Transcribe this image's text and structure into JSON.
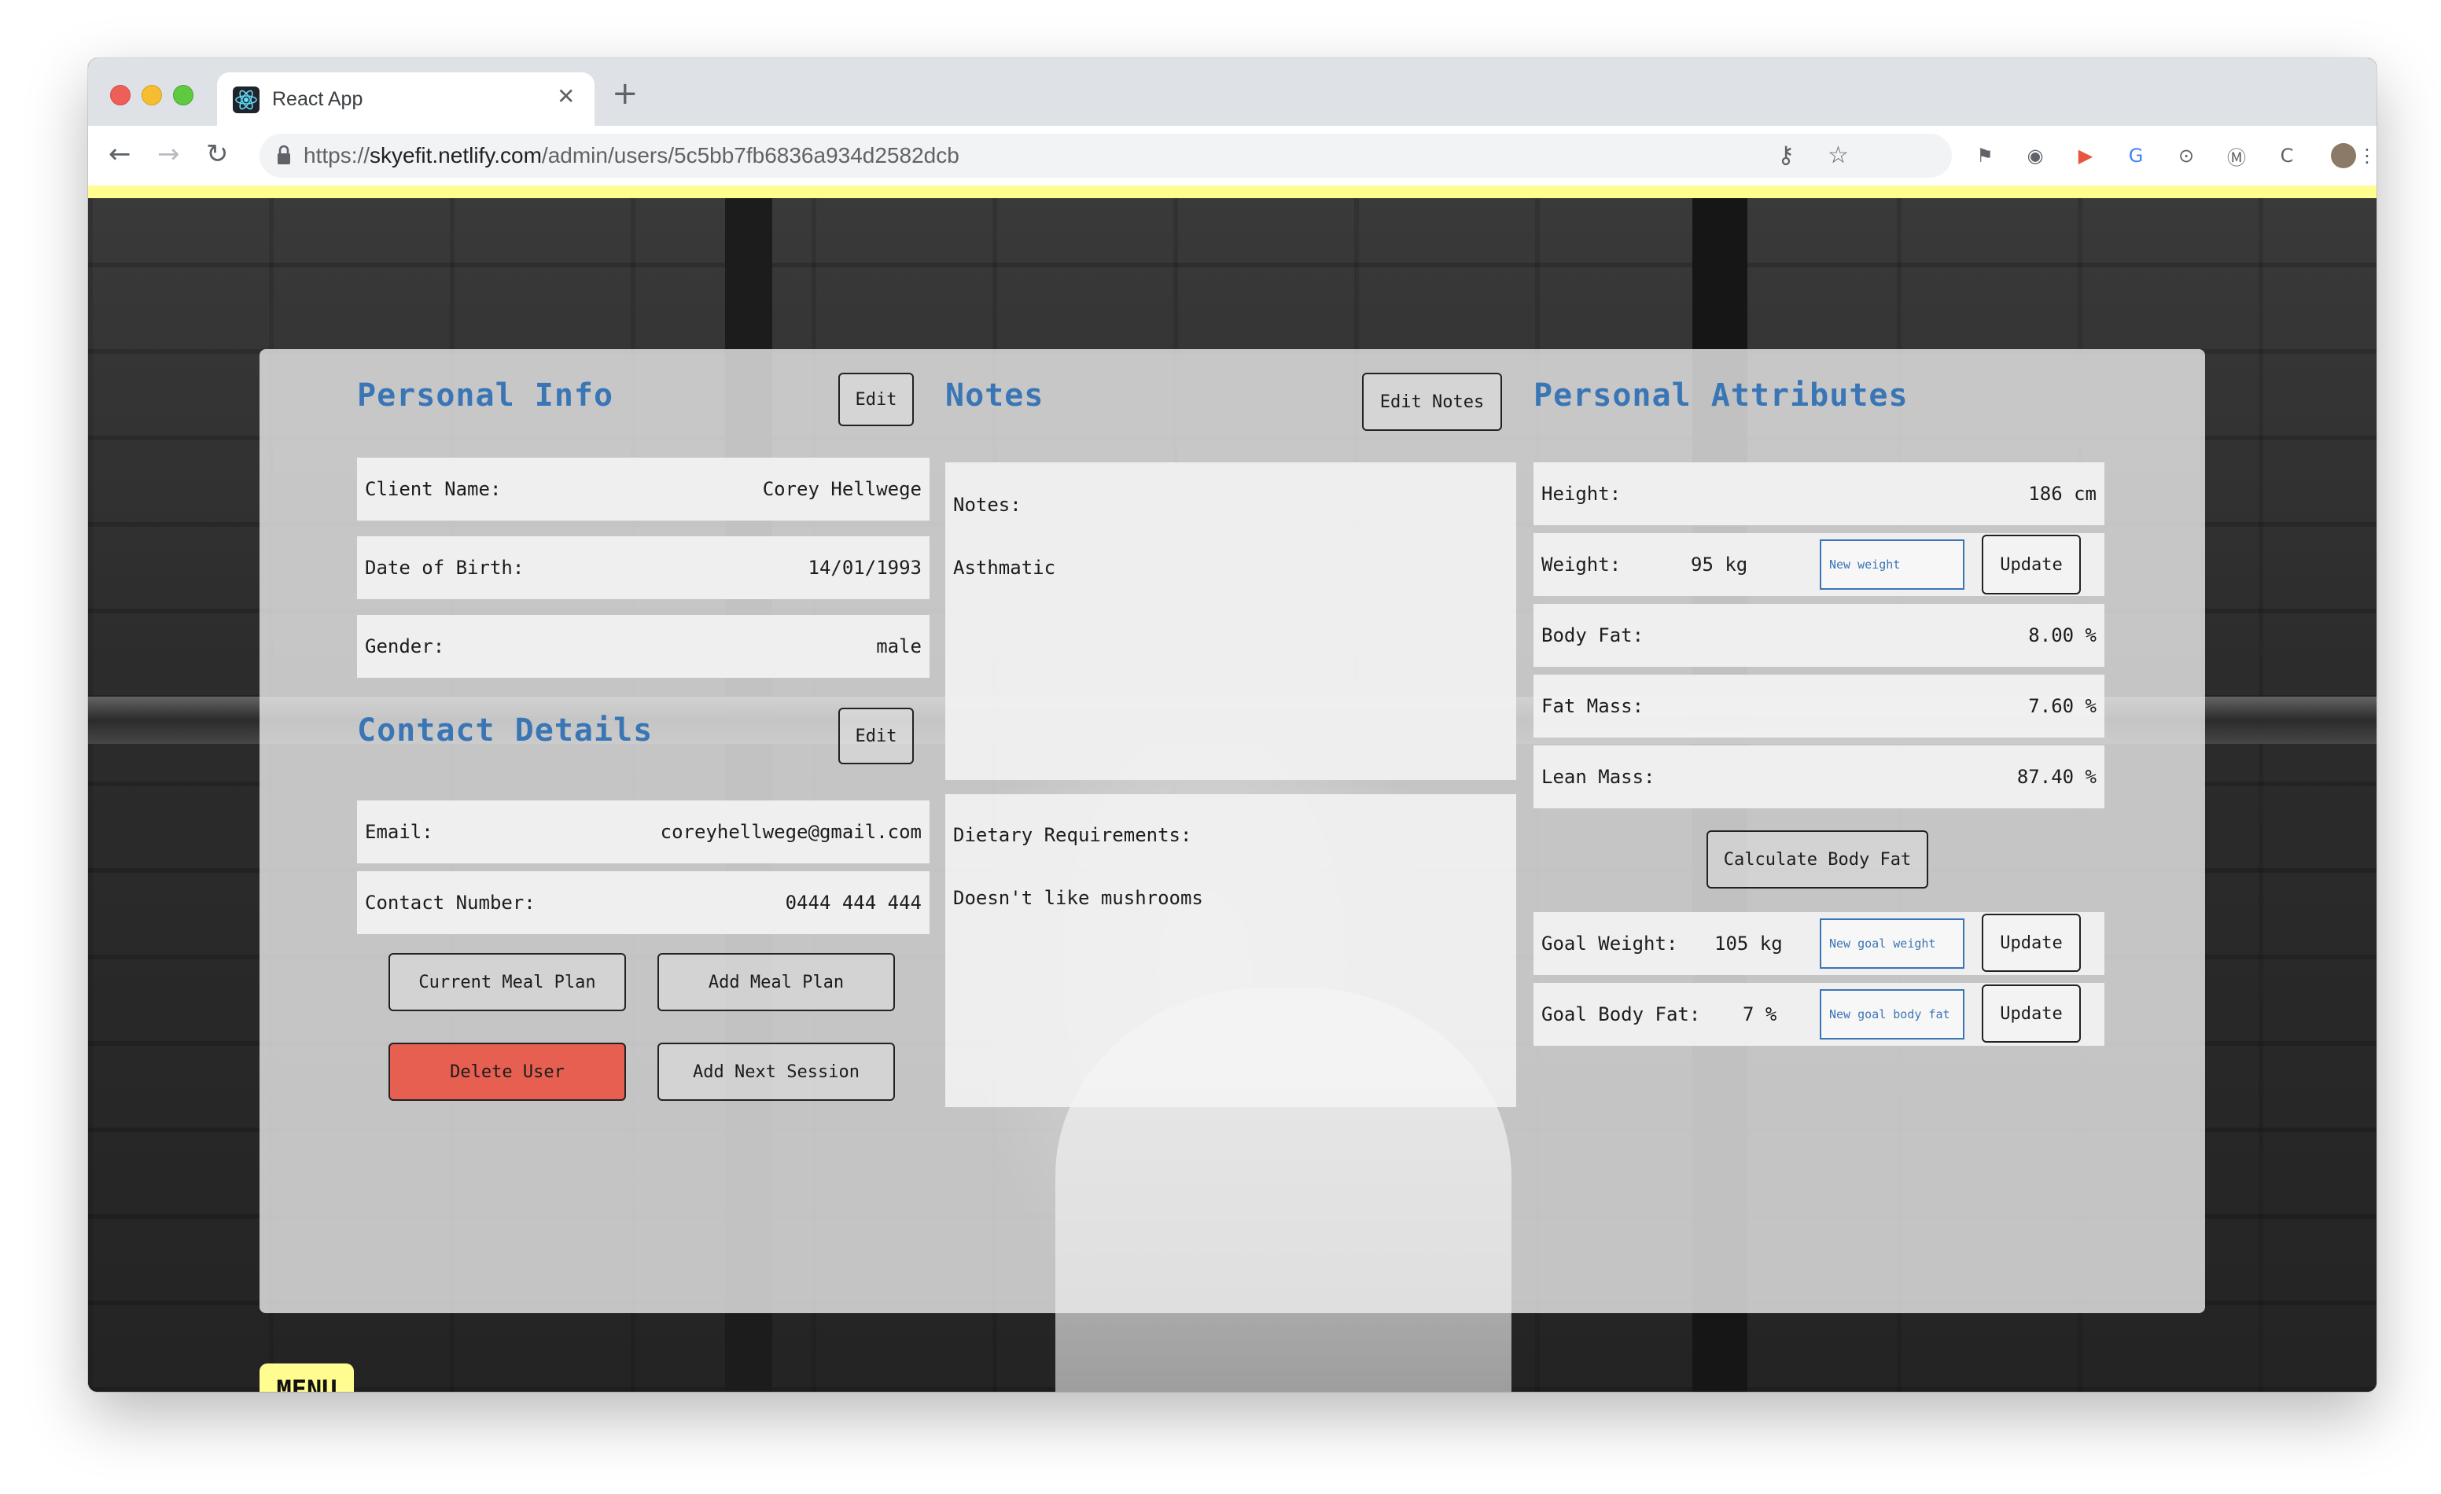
{
  "browser": {
    "tab_title": "React App",
    "tab_close": "✕",
    "new_tab": "+",
    "url_scheme": "https://",
    "url_host": "skyefit.netlify.com",
    "url_path": "/admin/users/5c5bb7fb6836a934d2582dcb",
    "icons": [
      "back-arrow",
      "forward-arrow",
      "reload",
      "lock",
      "key",
      "star",
      "extensions"
    ]
  },
  "personal_info": {
    "heading": "Personal Info",
    "edit_label": "Edit",
    "client_name_label": "Client Name:",
    "client_name": "Corey Hellwege",
    "dob_label": "Date of Birth:",
    "dob": "14/01/1993",
    "gender_label": "Gender:",
    "gender": "male"
  },
  "contact_details": {
    "heading": "Contact Details",
    "edit_label": "Edit",
    "email_label": "Email:",
    "email": "coreyhellwege@gmail.com",
    "phone_label": "Contact Number:",
    "phone": "0444 444 444"
  },
  "actions": {
    "current_meal_plan": "Current Meal Plan",
    "add_meal_plan": "Add Meal Plan",
    "delete_user": "Delete User",
    "add_next_session": "Add Next Session"
  },
  "notes": {
    "heading": "Notes",
    "edit_label": "Edit Notes",
    "notes_label": "Notes:",
    "notes_value": "Asthmatic",
    "dietary_label": "Dietary Requirements:",
    "dietary_value": "Doesn't like mushrooms"
  },
  "attributes": {
    "heading": "Personal Attributes",
    "height_label": "Height:",
    "height": "186 cm",
    "weight_label": "Weight:",
    "weight": "95 kg",
    "weight_placeholder": "New weight",
    "update_label": "Update",
    "body_fat_label": "Body Fat:",
    "body_fat": "8.00 %",
    "fat_mass_label": "Fat Mass:",
    "fat_mass": "7.60 %",
    "lean_mass_label": "Lean Mass:",
    "lean_mass": "87.40 %",
    "calculate_label": "Calculate Body Fat",
    "goal_weight_label": "Goal Weight:",
    "goal_weight": "105 kg",
    "goal_weight_placeholder": "New goal weight",
    "goal_body_fat_label": "Goal Body Fat:",
    "goal_body_fat": "7 %",
    "goal_body_fat_placeholder": "New goal body fat"
  },
  "menu": {
    "label": "MENU"
  },
  "colors": {
    "heading": "#3a76b5",
    "accent_yellow": "#fffd8f",
    "danger": "#e65f51"
  }
}
